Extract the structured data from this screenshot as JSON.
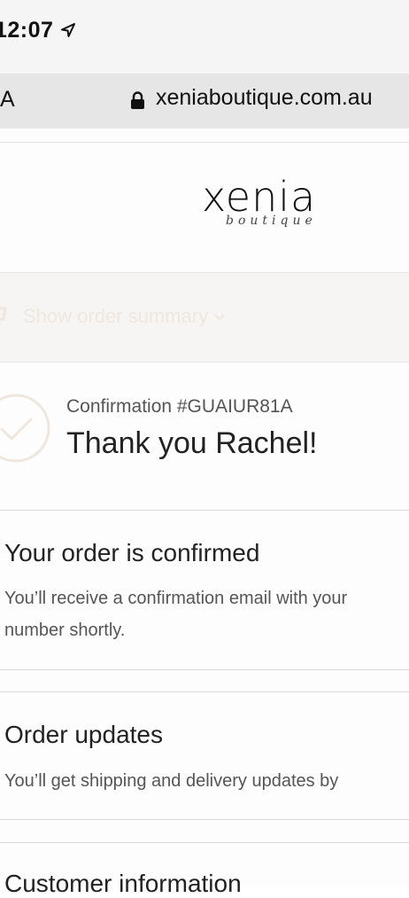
{
  "status_bar": {
    "time": "12:07"
  },
  "browser": {
    "left_text": "A",
    "url": "xeniaboutique.com.au"
  },
  "logo": {
    "main": "xenia",
    "sub": "boutique"
  },
  "summary": {
    "toggle_label": "Show order summary"
  },
  "confirmation": {
    "number": "Confirmation #GUAIUR81A",
    "thanks": "Thank you Rachel!"
  },
  "sections": {
    "confirmed": {
      "title": "Your order is confirmed",
      "line1": "You’ll receive a confirmation email with your",
      "line2": "number shortly."
    },
    "updates": {
      "title": "Order updates",
      "line1": "You’ll get shipping and delivery updates by"
    },
    "customer": {
      "title": "Customer information"
    }
  },
  "colors": {
    "accent": "#efe6de",
    "status_bg": "#f5f5f5",
    "url_bg": "#e6e6e6"
  },
  "icons": [
    "location-arrow-icon",
    "lock-icon",
    "cart-icon",
    "chevron-down-icon",
    "checkmark-circle-icon"
  ]
}
